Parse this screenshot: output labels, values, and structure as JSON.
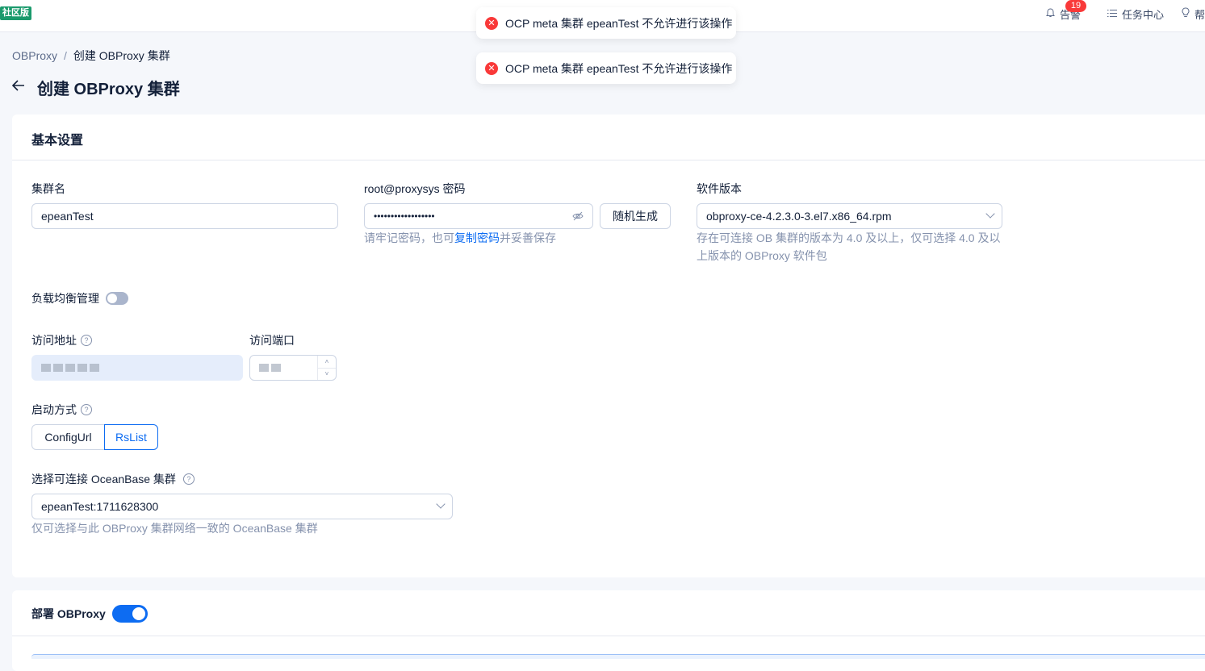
{
  "header": {
    "edition": "社区版",
    "alerts_label": "告警",
    "alerts_count": "19",
    "tasks_label": "任务中心",
    "help_label": "帮"
  },
  "toasts": [
    "OCP meta 集群 epeanTest 不允许进行该操作",
    "OCP meta 集群 epeanTest 不允许进行该操作"
  ],
  "breadcrumb": {
    "root": "OBProxy",
    "separator": "/",
    "current": "创建 OBProxy 集群"
  },
  "page_title": "创建 OBProxy 集群",
  "basic": {
    "title": "基本设置",
    "cluster_name_label": "集群名",
    "cluster_name_value": "epeanTest",
    "password_label": "root@proxysys 密码",
    "password_value": "••••••••••••••••••",
    "random_button": "随机生成",
    "password_help_prefix": "请牢记密码，也可",
    "password_help_link": "复制密码",
    "password_help_suffix": "并妥善保存",
    "version_label": "软件版本",
    "version_value": "obproxy-ce-4.2.3.0-3.el7.x86_64.rpm",
    "version_help_1": "存在可连接 OB 集群的版本为 4.0 及以上，仅可选择 4.0 及以",
    "version_help_2": "上版本的 OBProxy 软件包",
    "lb_label": "负载均衡管理",
    "address_label": "访问地址",
    "port_label": "访问端口",
    "startup_label": "启动方式",
    "startup_options": [
      "ConfigUrl",
      "RsList"
    ],
    "startup_selected": "RsList",
    "ob_cluster_label": "选择可连接 OceanBase 集群",
    "ob_cluster_value": "epeanTest:1711628300",
    "ob_cluster_help": "仅可选择与此 OBProxy 集群网络一致的 OceanBase 集群"
  },
  "deploy": {
    "title": "部署 OBProxy"
  },
  "colors": {
    "primary": "#0d6cf2",
    "error": "#f93939",
    "edition": "#1a9a6c"
  },
  "icons": [
    "bell-icon",
    "list-icon",
    "bulb-icon",
    "close-circle-icon",
    "arrow-left-icon",
    "eye-off-icon",
    "chevron-down-icon",
    "question-icon"
  ]
}
